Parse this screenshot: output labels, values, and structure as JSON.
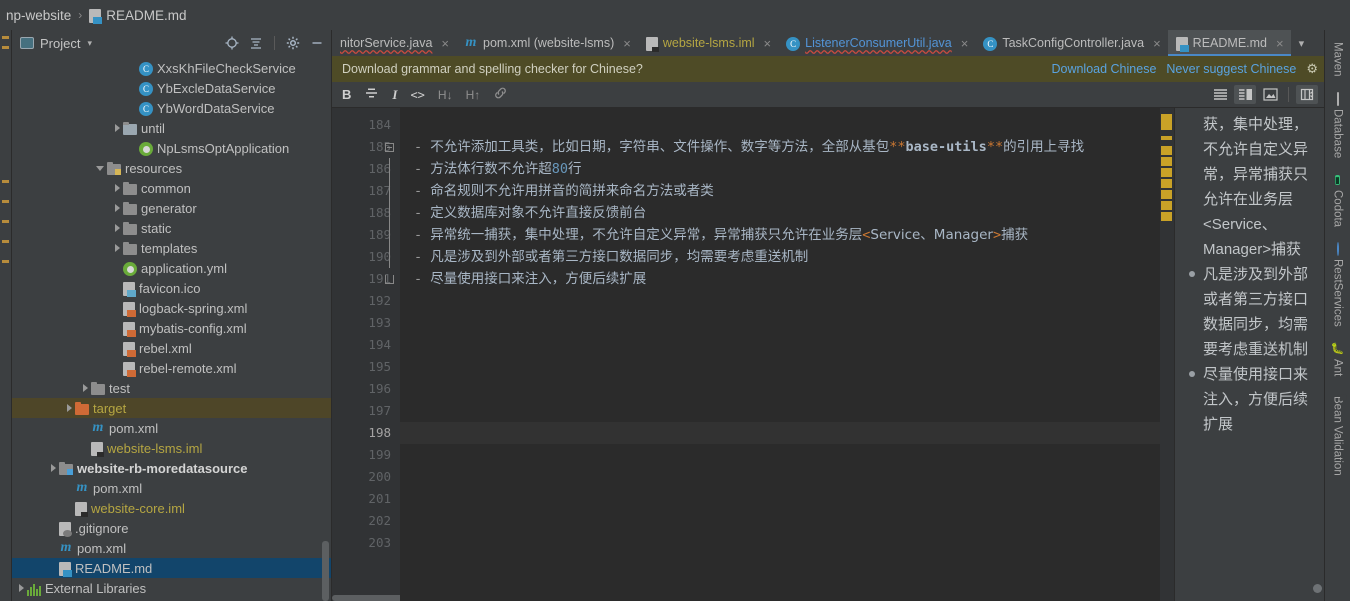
{
  "breadcrumb": {
    "project": "np-website",
    "separator": "›",
    "file": "README.md",
    "file_icon": "markdown-file-icon"
  },
  "project_panel": {
    "title": "Project",
    "caret": "▾",
    "icons": [
      {
        "name": "locate-file-icon",
        "glyph": "⊕"
      },
      {
        "name": "collapse-all-icon",
        "glyph": "⨍"
      },
      {
        "name": "settings-gear-icon",
        "glyph": "⚙"
      },
      {
        "name": "hide-panel-icon",
        "glyph": "—"
      }
    ],
    "tree": [
      {
        "label": "XxsKhFileCheckService",
        "icon": "class-icon",
        "indent": 7,
        "arrow": "none",
        "color": "c-default"
      },
      {
        "label": "YbExcleDataService",
        "icon": "class-icon",
        "indent": 7,
        "arrow": "none",
        "color": "c-default"
      },
      {
        "label": "YbWordDataService",
        "icon": "class-icon",
        "indent": 7,
        "arrow": "none",
        "color": "c-default"
      },
      {
        "label": "until",
        "icon": "package-icon",
        "indent": 6,
        "arrow": "closed",
        "color": "c-default"
      },
      {
        "label": "NpLsmsOptApplication",
        "icon": "spring-icon",
        "indent": 7,
        "arrow": "none",
        "color": "c-default"
      },
      {
        "label": "resources",
        "icon": "resources-folder-icon",
        "indent": 5,
        "arrow": "open",
        "color": "c-default"
      },
      {
        "label": "common",
        "icon": "folder-icon",
        "indent": 6,
        "arrow": "closed",
        "color": "c-default"
      },
      {
        "label": "generator",
        "icon": "folder-icon",
        "indent": 6,
        "arrow": "closed",
        "color": "c-default"
      },
      {
        "label": "static",
        "icon": "folder-icon",
        "indent": 6,
        "arrow": "closed",
        "color": "c-default"
      },
      {
        "label": "templates",
        "icon": "folder-icon",
        "indent": 6,
        "arrow": "closed",
        "color": "c-default"
      },
      {
        "label": "application.yml",
        "icon": "spring-yaml-icon",
        "indent": 6,
        "arrow": "none",
        "color": "c-default"
      },
      {
        "label": "favicon.ico",
        "icon": "image-file-icon",
        "indent": 6,
        "arrow": "none",
        "color": "c-default"
      },
      {
        "label": "logback-spring.xml",
        "icon": "xml-file-icon",
        "indent": 6,
        "arrow": "none",
        "color": "c-default"
      },
      {
        "label": "mybatis-config.xml",
        "icon": "xml-file-icon",
        "indent": 6,
        "arrow": "none",
        "color": "c-default"
      },
      {
        "label": "rebel.xml",
        "icon": "xml-file-icon",
        "indent": 6,
        "arrow": "none",
        "color": "c-default"
      },
      {
        "label": "rebel-remote.xml",
        "icon": "xml-file-icon",
        "indent": 6,
        "arrow": "none",
        "color": "c-default"
      },
      {
        "label": "test",
        "icon": "folder-icon",
        "indent": 4,
        "arrow": "closed",
        "color": "c-default"
      },
      {
        "label": "target",
        "icon": "target-folder-icon",
        "indent": 3,
        "arrow": "closed",
        "color": "c-yellow",
        "state": "sel-olive"
      },
      {
        "label": "pom.xml",
        "icon": "maven-icon",
        "indent": 4,
        "arrow": "none",
        "color": "c-default"
      },
      {
        "label": "website-lsms.iml",
        "icon": "iml-file-icon",
        "indent": 4,
        "arrow": "none",
        "color": "c-yellow"
      },
      {
        "label": "website-rb-moredatasource",
        "icon": "module-folder-icon",
        "indent": 2,
        "arrow": "closed",
        "color": "c-white",
        "bold": true
      },
      {
        "label": "pom.xml",
        "icon": "maven-icon",
        "indent": 3,
        "arrow": "none",
        "color": "c-default"
      },
      {
        "label": "website-core.iml",
        "icon": "iml-file-icon",
        "indent": 3,
        "arrow": "none",
        "color": "c-yellow"
      },
      {
        "label": ".gitignore",
        "icon": "gitignore-icon",
        "indent": 2,
        "arrow": "none",
        "color": "c-default"
      },
      {
        "label": "pom.xml",
        "icon": "maven-icon",
        "indent": 2,
        "arrow": "none",
        "color": "c-default"
      },
      {
        "label": "README.md",
        "icon": "markdown-file-icon",
        "indent": 2,
        "arrow": "none",
        "color": "c-default",
        "state": "sel-blue"
      },
      {
        "label": "External Libraries",
        "icon": "libraries-icon",
        "indent": 0,
        "arrow": "closed",
        "color": "c-default"
      }
    ]
  },
  "editor": {
    "tabs": [
      {
        "label": "nitorService.java",
        "icon": "none",
        "style": "err",
        "active": false,
        "closable": true
      },
      {
        "label": "pom.xml (website-lsms)",
        "icon": "maven-icon",
        "style": "",
        "active": false,
        "closable": true
      },
      {
        "label": "website-lsms.iml",
        "icon": "iml-file-icon",
        "style": "yellow",
        "active": false,
        "closable": true
      },
      {
        "label": "ListenerConsumerUtil.java",
        "icon": "class-icon",
        "style": "link err",
        "active": false,
        "closable": true
      },
      {
        "label": "TaskConfigController.java",
        "icon": "class-icon",
        "style": "",
        "active": false,
        "closable": true
      },
      {
        "label": "README.md",
        "icon": "markdown-file-icon",
        "style": "",
        "active": true,
        "closable": true
      }
    ],
    "tabs_overflow_icon": "chevron-down-icon",
    "notification": {
      "message": "Download grammar and spelling checker for Chinese?",
      "actions": [
        "Download Chinese",
        "Never suggest Chinese"
      ],
      "gear_icon": "gear-icon"
    },
    "md_toolbar": [
      {
        "name": "bold-button",
        "glyph": "B",
        "enabled": true
      },
      {
        "name": "strikethrough-button",
        "glyph": "S̶",
        "enabled": true
      },
      {
        "name": "italic-button",
        "glyph": "I",
        "enabled": true
      },
      {
        "name": "code-button",
        "glyph": "<>",
        "enabled": true
      },
      {
        "name": "heading-down-button",
        "glyph": "H↓",
        "enabled": false
      },
      {
        "name": "heading-up-button",
        "glyph": "H↑",
        "enabled": false
      },
      {
        "name": "link-button",
        "glyph": "ὑ7",
        "enabled": false
      }
    ],
    "view_modes": [
      {
        "name": "editor-only-button",
        "active": false
      },
      {
        "name": "split-view-button",
        "active": true
      },
      {
        "name": "preview-only-button",
        "active": false
      },
      {
        "name": "sync-scroll-button",
        "active": false
      }
    ],
    "current_line": 198,
    "lines": [
      {
        "n": 184,
        "text": "",
        "bullet": false
      },
      {
        "n": 185,
        "text": "不允许添加工具类，比如日期，字符串、文件操作、数字等方法，全部从基",
        "bullet": true,
        "tail_bold_marks": "**",
        "tail_bold": "base-utils",
        "tail_bold_marks2": "**",
        "tail_after": "的引用上寻找",
        "tail_pre": "包"
      },
      {
        "n": 186,
        "text": "方法体行数不允许超",
        "bullet": true,
        "num": "80",
        "text2": "行"
      },
      {
        "n": 187,
        "text": "命名规则不允许用拼音的简拼来命名方法或者类",
        "bullet": true
      },
      {
        "n": 188,
        "text": "定义数据库对象不允许直接反馈前台",
        "bullet": true
      },
      {
        "n": 189,
        "text": "异常统一捕获，集中处理，不允许自定义异常，异常捕获只允许在业务层",
        "bullet": true,
        "angle_open": "<",
        "angle_text": "Service、Manager",
        "angle_close": ">",
        "tail_after": "捕获"
      },
      {
        "n": 190,
        "text": "凡是涉及到外部或者第三方接口数据同步，均需要考虑重送机制",
        "bullet": true
      },
      {
        "n": 191,
        "text": "尽量使用接口来注入，方便后续扩展",
        "bullet": true
      },
      {
        "n": 192,
        "text": "",
        "bullet": false
      },
      {
        "n": 193,
        "text": "",
        "bullet": false
      },
      {
        "n": 194,
        "text": "",
        "bullet": false
      },
      {
        "n": 195,
        "text": "",
        "bullet": false
      },
      {
        "n": 196,
        "text": "",
        "bullet": false
      },
      {
        "n": 197,
        "text": "",
        "bullet": false
      },
      {
        "n": 198,
        "text": "",
        "bullet": false
      },
      {
        "n": 199,
        "text": "",
        "bullet": false
      },
      {
        "n": 200,
        "text": "",
        "bullet": false
      },
      {
        "n": 201,
        "text": "",
        "bullet": false
      },
      {
        "n": 202,
        "text": "",
        "bullet": false
      },
      {
        "n": 203,
        "text": "",
        "bullet": false
      }
    ]
  },
  "preview": {
    "blocks": [
      {
        "bullet": false,
        "text": "获，集中处理，不允许自定义异常，异常捕获只允许在业务层<Service、Manager>捕获"
      },
      {
        "bullet": true,
        "text": "凡是涉及到外部或者第三方接口数据同步，均需要考虑重送机制"
      },
      {
        "bullet": true,
        "text": "尽量使用接口来注入，方便后续扩展"
      }
    ]
  },
  "right_rail": {
    "tabs": [
      {
        "label": "Maven",
        "icon": "maven-icon"
      },
      {
        "label": "Database",
        "icon": "database-icon"
      },
      {
        "label": "Codota",
        "icon": "codota-icon"
      },
      {
        "label": "RestServices",
        "icon": "rest-services-icon"
      },
      {
        "label": "Ant",
        "icon": "ant-icon"
      },
      {
        "label": "Bean Validation",
        "icon": "bean-validation-icon"
      }
    ]
  },
  "colors": {
    "background": "#3c3f41",
    "editor_background": "#2b2b2b",
    "accent_blue": "#4a88c7",
    "selection_blue": "#12456b",
    "notification_olive": "#4e4b26",
    "warning_marker": "#c9a227",
    "link": "#5aa3e0",
    "iml_yellow": "#b5a642",
    "markdown_bold_mark": "#cc7832"
  }
}
